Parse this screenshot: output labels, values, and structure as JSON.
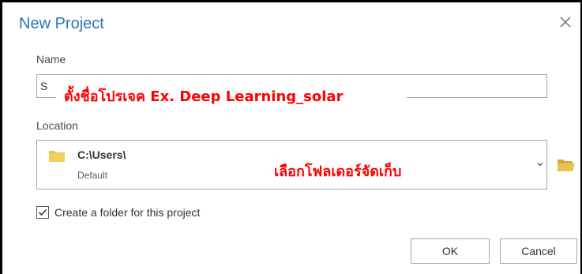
{
  "dialog": {
    "title": "New Project",
    "close_icon": "close-icon"
  },
  "name": {
    "label": "Name",
    "value": "S"
  },
  "location": {
    "label": "Location",
    "path": "C:\\Users\\",
    "subtext": "Default",
    "folder_icon": "folder-icon",
    "dropdown_icon": "chevron-down-icon",
    "browse_icon": "folder-open-icon"
  },
  "annotations": {
    "name_hint": "ตั้งชื่อโปรเจค Ex. Deep Learning_solar",
    "location_hint": "เลือกโฟลเดอร์จัดเก็บ"
  },
  "options": {
    "create_folder_label": "Create a folder for this project",
    "create_folder_checked": true
  },
  "buttons": {
    "ok_label": "OK",
    "cancel_label": "Cancel"
  },
  "colors": {
    "title": "#2f75b5",
    "annotation": "#ff0000",
    "folder": "#e8c350"
  }
}
